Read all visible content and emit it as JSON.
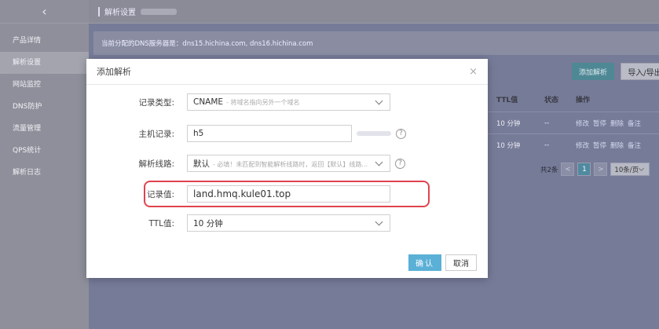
{
  "sidebar": {
    "back_icon": "chevron-left-icon",
    "items": [
      {
        "label": "产品详情"
      },
      {
        "label": "解析设置"
      },
      {
        "label": "网站监控"
      },
      {
        "label": "DNS防护"
      },
      {
        "label": "流量管理"
      },
      {
        "label": "QPS统计"
      },
      {
        "label": "解析日志"
      }
    ]
  },
  "header": {
    "title": "解析设置"
  },
  "notice": {
    "text": "当前分配的DNS服务器是：dns15.hichina.com, dns16.hichina.com"
  },
  "toolbar": {
    "add_label": "添加解析",
    "import_label": "导入/导出"
  },
  "table": {
    "headers": {
      "ttl": "TTL值",
      "status": "状态",
      "ops": "操作"
    },
    "rows": [
      {
        "ttl": "10 分钟",
        "status": "--",
        "ops": [
          "修改",
          "暂停",
          "删除",
          "备注"
        ]
      },
      {
        "ttl": "10 分钟",
        "status": "--",
        "ops": [
          "修改",
          "暂停",
          "删除",
          "备注"
        ]
      }
    ]
  },
  "pager": {
    "total": "共2条",
    "prev": "<",
    "current": "1",
    "next": ">",
    "page_size": "10条/页"
  },
  "modal": {
    "title": "添加解析",
    "close": "×",
    "fields": {
      "record_type": {
        "label": "记录类型:",
        "value": "CNAME",
        "hint": "- 将域名指向另外一个域名"
      },
      "host": {
        "label": "主机记录:",
        "value": "h5"
      },
      "line": {
        "label": "解析线路:",
        "value": "默认",
        "hint": "- 必填！未匹配到智能解析线路时，返回【默认】线路..."
      },
      "record_value": {
        "label": "记录值:",
        "value": "land.hmq.kule01.top"
      },
      "ttl": {
        "label": "TTL值:",
        "value": "10 分钟"
      }
    },
    "ok_label": "确认",
    "cancel_label": "取消"
  },
  "colors": {
    "highlight": "#e0434f",
    "primary": "#5ab0d6"
  }
}
